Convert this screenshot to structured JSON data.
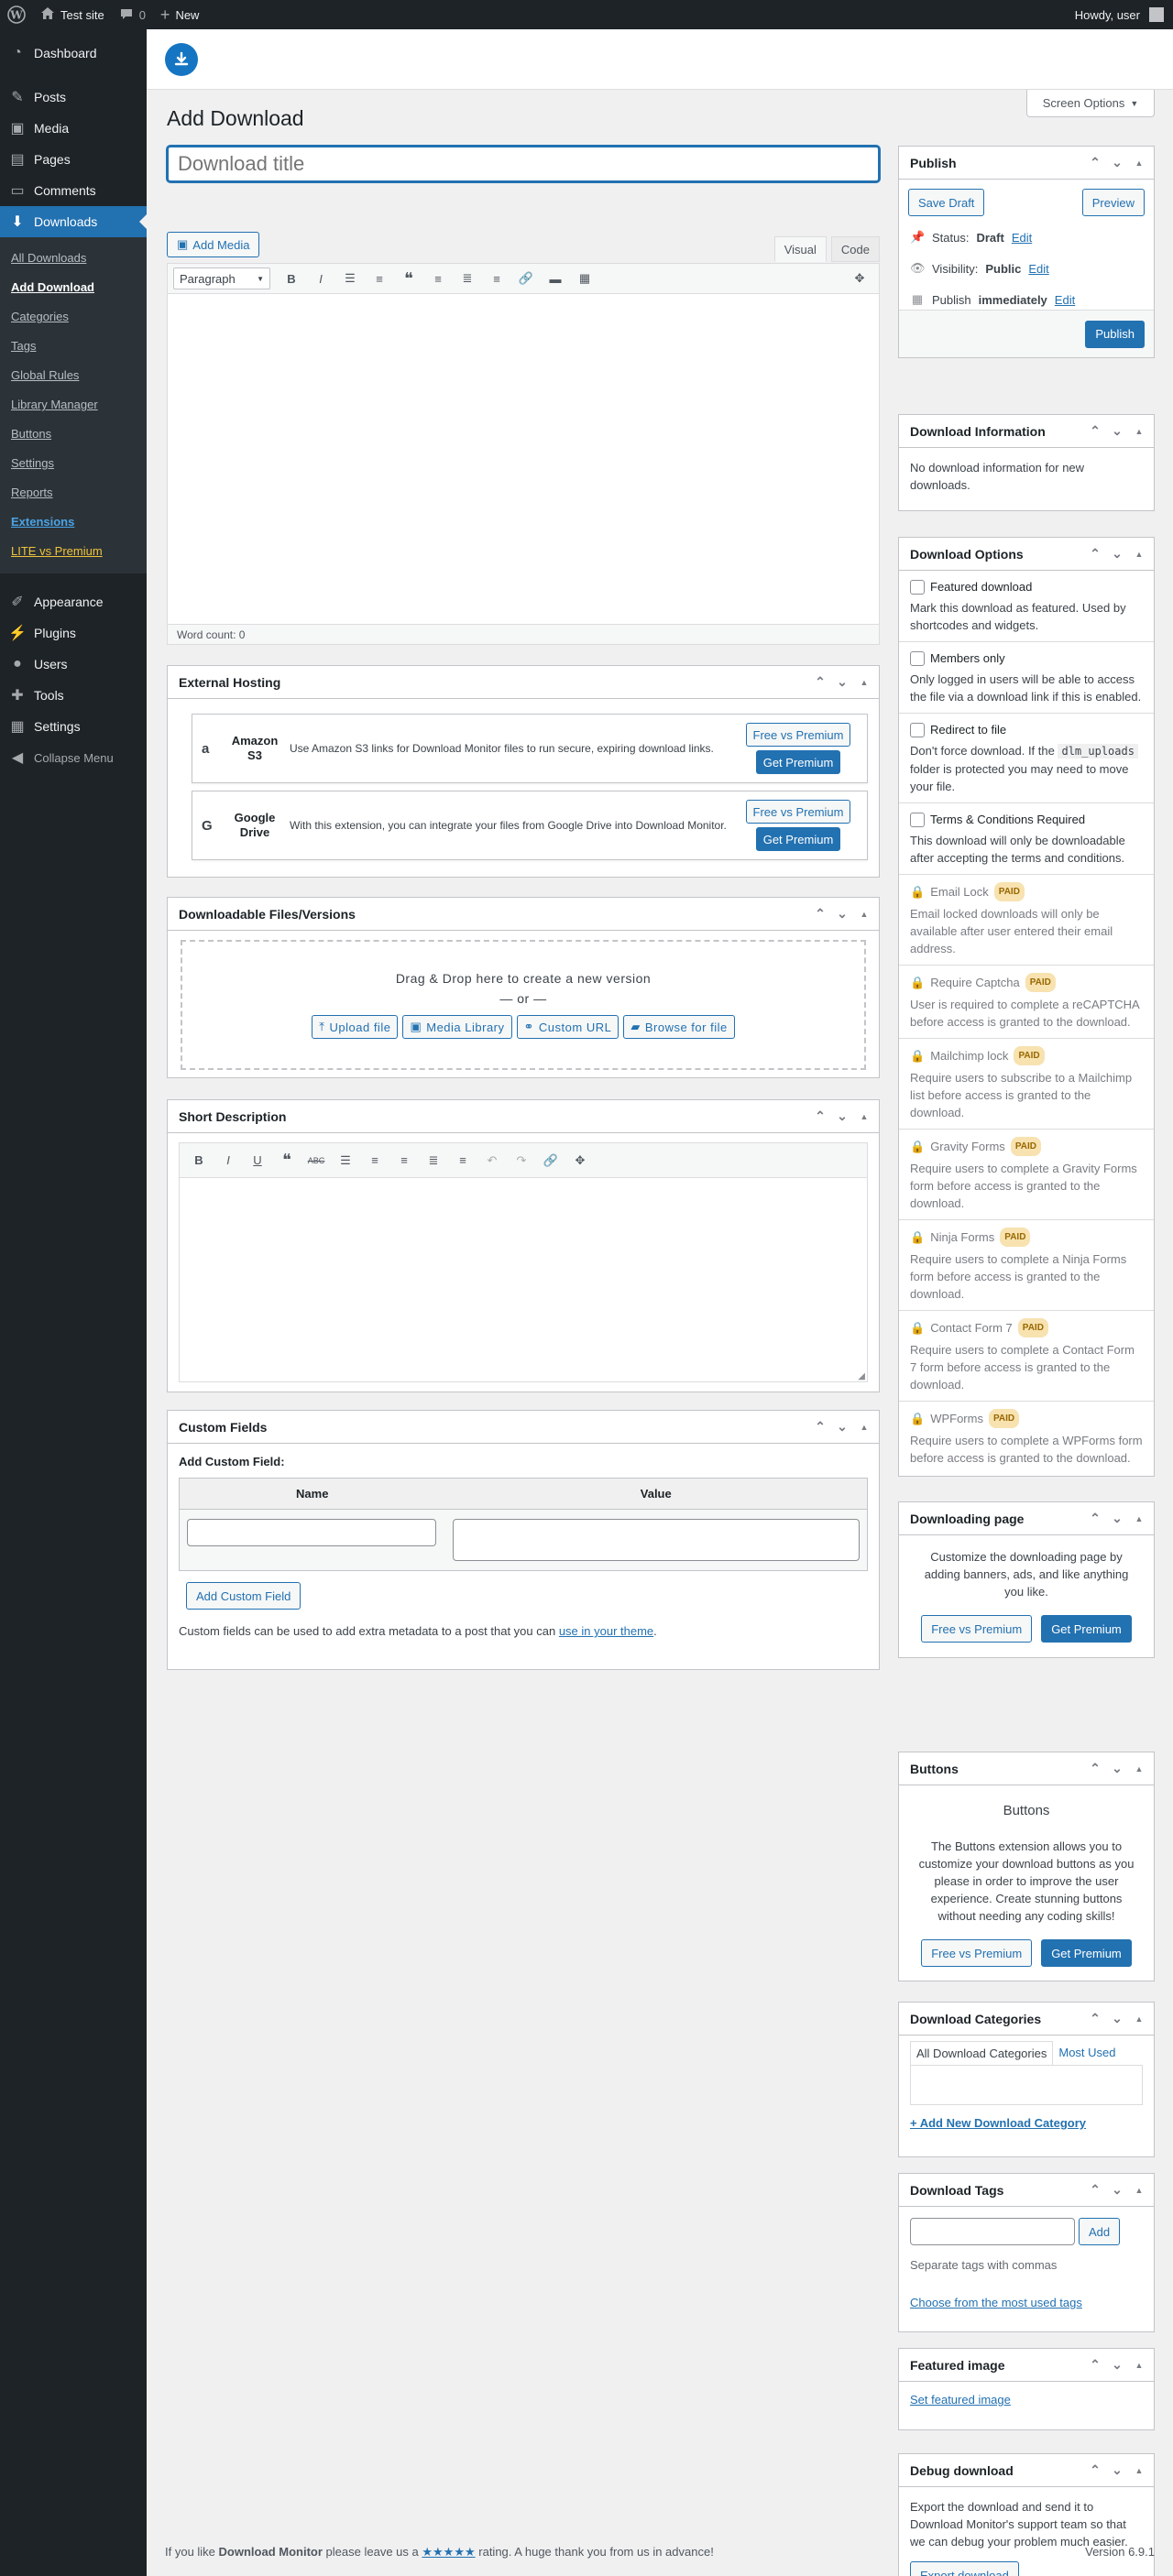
{
  "adminbar": {
    "site": "Test site",
    "comments": "0",
    "new": "New",
    "howdy": "Howdy, user"
  },
  "menu": {
    "dashboard": "Dashboard",
    "posts": "Posts",
    "media": "Media",
    "pages": "Pages",
    "comments": "Comments",
    "downloads": "Downloads",
    "submenu": [
      "All Downloads",
      "Add Download",
      "Categories",
      "Tags",
      "Global Rules",
      "Library Manager",
      "Buttons",
      "Settings",
      "Reports",
      "Extensions",
      "LITE vs Premium"
    ],
    "appearance": "Appearance",
    "plugins": "Plugins",
    "users": "Users",
    "tools": "Tools",
    "settings": "Settings",
    "collapse": "Collapse Menu"
  },
  "page": {
    "title": "Add Download",
    "screen_options": "Screen Options",
    "title_placeholder": "Download title"
  },
  "editor": {
    "add_media": "Add Media",
    "tab_visual": "Visual",
    "tab_code": "Code",
    "paragraph": "Paragraph",
    "word_count": "Word count: 0"
  },
  "external_hosting": {
    "title": "External Hosting",
    "items": [
      {
        "name": "Amazon S3",
        "desc": "Use Amazon S3 links for Download Monitor files to run secure, expiring download links.",
        "btn1": "Free vs Premium",
        "btn2": "Get Premium"
      },
      {
        "name": "Google Drive",
        "desc": "With this extension, you can integrate your files from Google Drive into Download Monitor.",
        "btn1": "Free vs Premium",
        "btn2": "Get Premium"
      }
    ]
  },
  "files": {
    "title": "Downloadable Files/Versions",
    "drag": "Drag & Drop here to create a new version",
    "or": "— or —",
    "upload": "Upload file",
    "library": "Media Library",
    "custom_url": "Custom URL",
    "browse": "Browse for file"
  },
  "short_desc": {
    "title": "Short Description"
  },
  "custom_fields": {
    "title": "Custom Fields",
    "add_label": "Add Custom Field:",
    "col_name": "Name",
    "col_value": "Value",
    "add_btn": "Add Custom Field",
    "note": "Custom fields can be used to add extra metadata to a post that you can",
    "note_link": "use in your theme",
    "note_end": "."
  },
  "publish": {
    "title": "Publish",
    "save_draft": "Save Draft",
    "preview": "Preview",
    "status_label": "Status:",
    "status_value": "Draft",
    "visibility_label": "Visibility:",
    "visibility_value": "Public",
    "publish_label": "Publish",
    "publish_value": "immediately",
    "edit": "Edit",
    "publish_btn": "Publish"
  },
  "download_info": {
    "title": "Download Information",
    "text": "No download information for new downloads."
  },
  "download_options": {
    "title": "Download Options",
    "options": [
      {
        "label": "Featured download",
        "desc": "Mark this download as featured. Used by shortcodes and widgets."
      },
      {
        "label": "Members only",
        "desc": "Only logged in users will be able to access the file via a download link if this is enabled."
      },
      {
        "label": "Redirect to file",
        "desc_pre": "Don't force download. If the",
        "code": "dlm_uploads",
        "desc_post": "folder is protected you may need to move your file."
      },
      {
        "label": "Terms & Conditions Required",
        "desc": "This download will only be downloadable after accepting the terms and conditions."
      }
    ],
    "paid_label": "PAID",
    "locked": [
      {
        "label": "Email Lock",
        "desc": "Email locked downloads will only be available after user entered their email address."
      },
      {
        "label": "Require Captcha",
        "desc": "User is required to complete a reCAPTCHA before access is granted to the download."
      },
      {
        "label": "Mailchimp lock",
        "desc": "Require users to subscribe to a Mailchimp list before access is granted to the download."
      },
      {
        "label": "Gravity Forms",
        "desc": "Require users to complete a Gravity Forms form before access is granted to the download."
      },
      {
        "label": "Ninja Forms",
        "desc": "Require users to complete a Ninja Forms form before access is granted to the download."
      },
      {
        "label": "Contact Form 7",
        "desc": "Require users to complete a Contact Form 7 form before access is granted to the download."
      },
      {
        "label": "WPForms",
        "desc": "Require users to complete a WPForms form before access is granted to the download."
      }
    ]
  },
  "downloading_page": {
    "title": "Downloading page",
    "text": "Customize the downloading page by adding banners, ads, and like anything you like.",
    "btn1": "Free vs Premium",
    "btn2": "Get Premium"
  },
  "buttons_box": {
    "title": "Buttons",
    "heading": "Buttons",
    "text": "The Buttons extension allows you to customize your download buttons as you please in order to improve the user experience. Create stunning buttons without needing any coding skills!",
    "btn1": "Free vs Premium",
    "btn2": "Get Premium"
  },
  "categories": {
    "title": "Download Categories",
    "tab_all": "All Download Categories",
    "tab_most": "Most Used",
    "add_new": "+ Add New Download Category"
  },
  "tags": {
    "title": "Download Tags",
    "add": "Add",
    "hint": "Separate tags with commas",
    "choose": "Choose from the most used tags"
  },
  "featured_image": {
    "title": "Featured image",
    "link": "Set featured image"
  },
  "debug": {
    "title": "Debug download",
    "text": "Export the download and send it to Download Monitor's support team so that we can debug your problem much easier.",
    "btn": "Export download"
  },
  "footer": {
    "pre": "If you like",
    "brand": "Download Monitor",
    "mid": "please leave us a",
    "stars": "★★★★★",
    "post": "rating. A huge thank you from us in advance!",
    "version": "Version 6.9.1"
  }
}
